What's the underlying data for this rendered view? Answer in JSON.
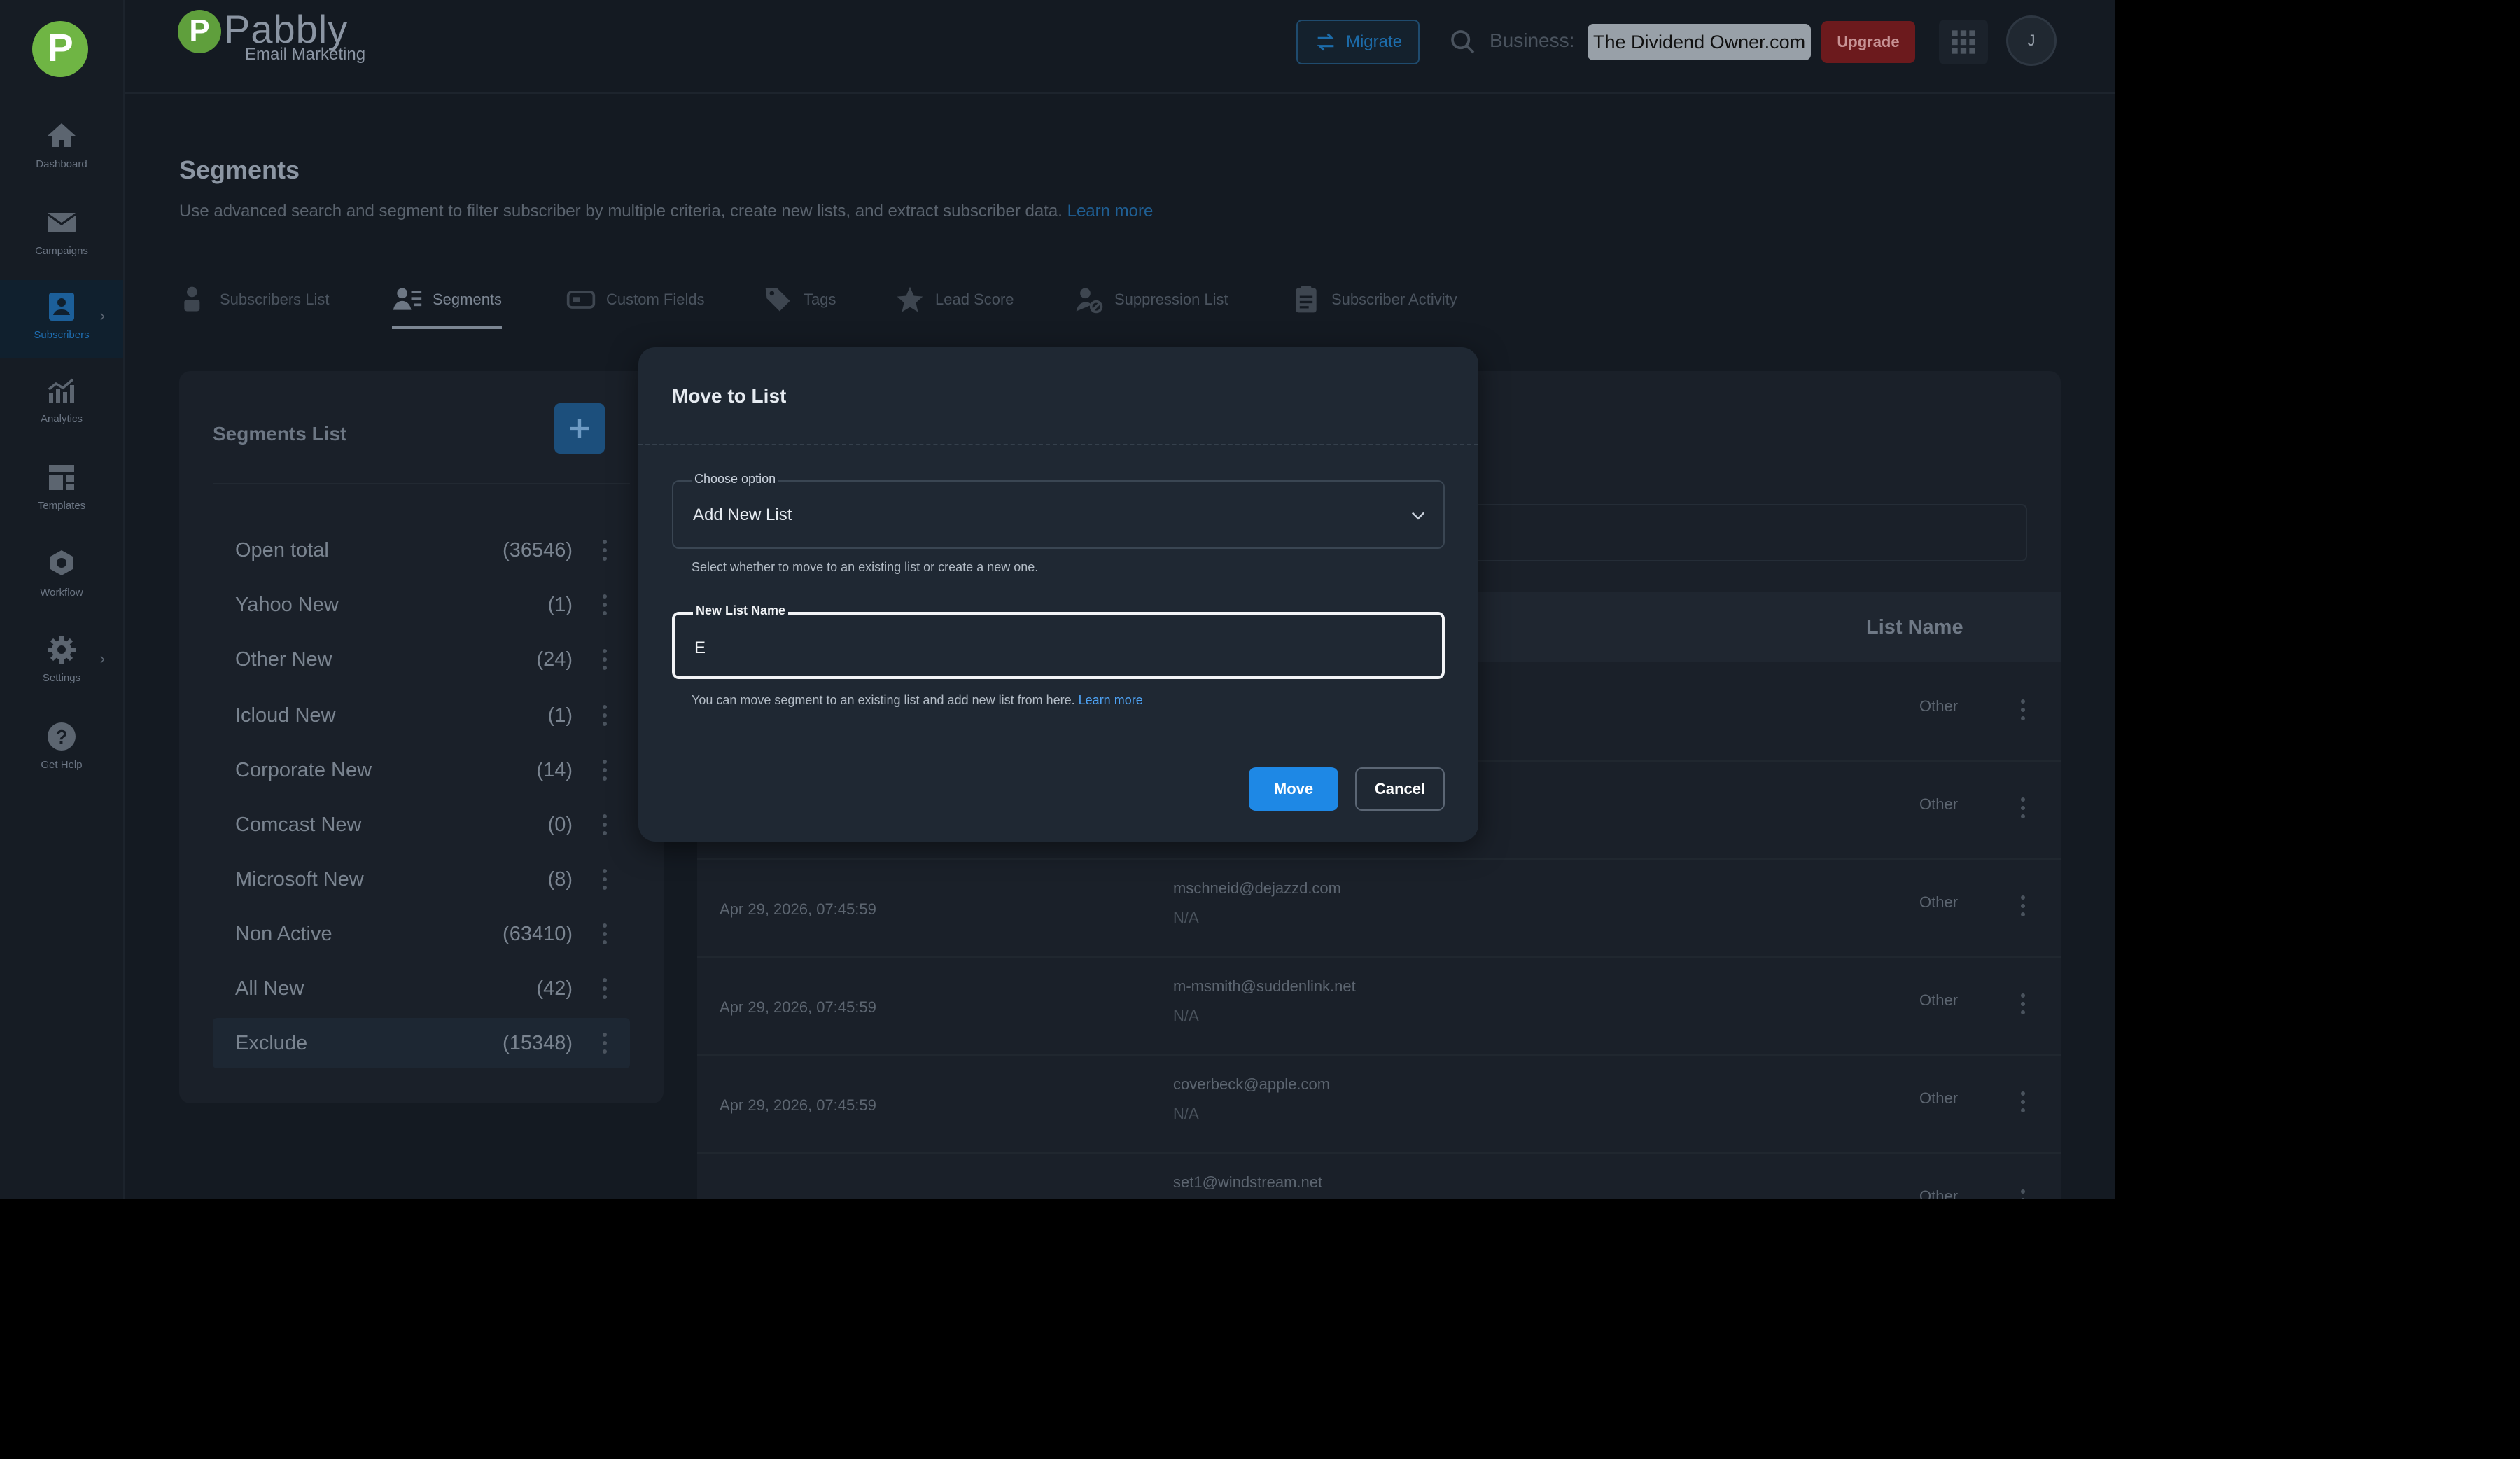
{
  "sidebar": {
    "items": [
      {
        "label": "Dashboard",
        "icon": "home-icon"
      },
      {
        "label": "Campaigns",
        "icon": "mail-icon"
      },
      {
        "label": "Subscribers",
        "icon": "subscribers-icon",
        "active": true
      },
      {
        "label": "Analytics",
        "icon": "analytics-icon"
      },
      {
        "label": "Templates",
        "icon": "templates-icon"
      },
      {
        "label": "Workflow",
        "icon": "workflow-icon"
      },
      {
        "label": "Settings",
        "icon": "gear-icon"
      },
      {
        "label": "Get Help",
        "icon": "help-icon"
      }
    ]
  },
  "header": {
    "brand_name": "Pabbly",
    "brand_sub": "Email Marketing",
    "migrate_label": "Migrate",
    "business_label": "Business:",
    "business_value": "The Dividend Owner.com",
    "upgrade_label": "Upgrade",
    "avatar_initial": "J"
  },
  "page": {
    "title": "Segments",
    "description": "Use advanced search and segment to filter subscriber by multiple criteria, create new lists, and extract subscriber data.",
    "learn_more": "Learn more"
  },
  "tabs": [
    {
      "label": "Subscribers List"
    },
    {
      "label": "Segments",
      "active": true
    },
    {
      "label": "Custom Fields"
    },
    {
      "label": "Tags"
    },
    {
      "label": "Lead Score"
    },
    {
      "label": "Suppression List"
    },
    {
      "label": "Subscriber Activity"
    }
  ],
  "segments": {
    "title": "Segments List",
    "items": [
      {
        "name": "Open total",
        "count": "(36546)"
      },
      {
        "name": "Yahoo New",
        "count": "(1)"
      },
      {
        "name": "Other New",
        "count": "(24)"
      },
      {
        "name": "Icloud New",
        "count": "(1)"
      },
      {
        "name": "Corporate New",
        "count": "(14)"
      },
      {
        "name": "Comcast New",
        "count": "(0)"
      },
      {
        "name": "Microsoft New",
        "count": "(8)"
      },
      {
        "name": "Non Active",
        "count": "(63410)"
      },
      {
        "name": "All New",
        "count": "(42)"
      },
      {
        "name": "Exclude",
        "count": "(15348)",
        "active": true
      }
    ]
  },
  "table": {
    "header_list_name": "List Name",
    "rows": [
      {
        "date": "",
        "email": "",
        "na": "",
        "list": "Other"
      },
      {
        "date": "",
        "email": "",
        "na": "",
        "list": "Other"
      },
      {
        "date": "Apr 29, 2026, 07:45:59",
        "email": "mschneid@dejazzd.com",
        "na": "N/A",
        "list": "Other"
      },
      {
        "date": "Apr 29, 2026, 07:45:59",
        "email": "m-msmith@suddenlink.net",
        "na": "N/A",
        "list": "Other"
      },
      {
        "date": "Apr 29, 2026, 07:45:59",
        "email": "coverbeck@apple.com",
        "na": "N/A",
        "list": "Other"
      },
      {
        "date": "",
        "email": "set1@windstream.net",
        "na": "",
        "list": "Other"
      }
    ]
  },
  "modal": {
    "title": "Move to List",
    "choose_label": "Choose option",
    "choose_value": "Add New List",
    "choose_help": "Select whether to move to an existing list or create a new one.",
    "name_label": "New List Name",
    "name_value": "E",
    "name_help": "You can move segment to an existing list and add new list from here.",
    "name_help_link": "Learn more",
    "move_label": "Move",
    "cancel_label": "Cancel"
  },
  "colors": {
    "accent": "#1e88e5",
    "upgrade": "#e53935",
    "brand_green": "#6fb544"
  }
}
